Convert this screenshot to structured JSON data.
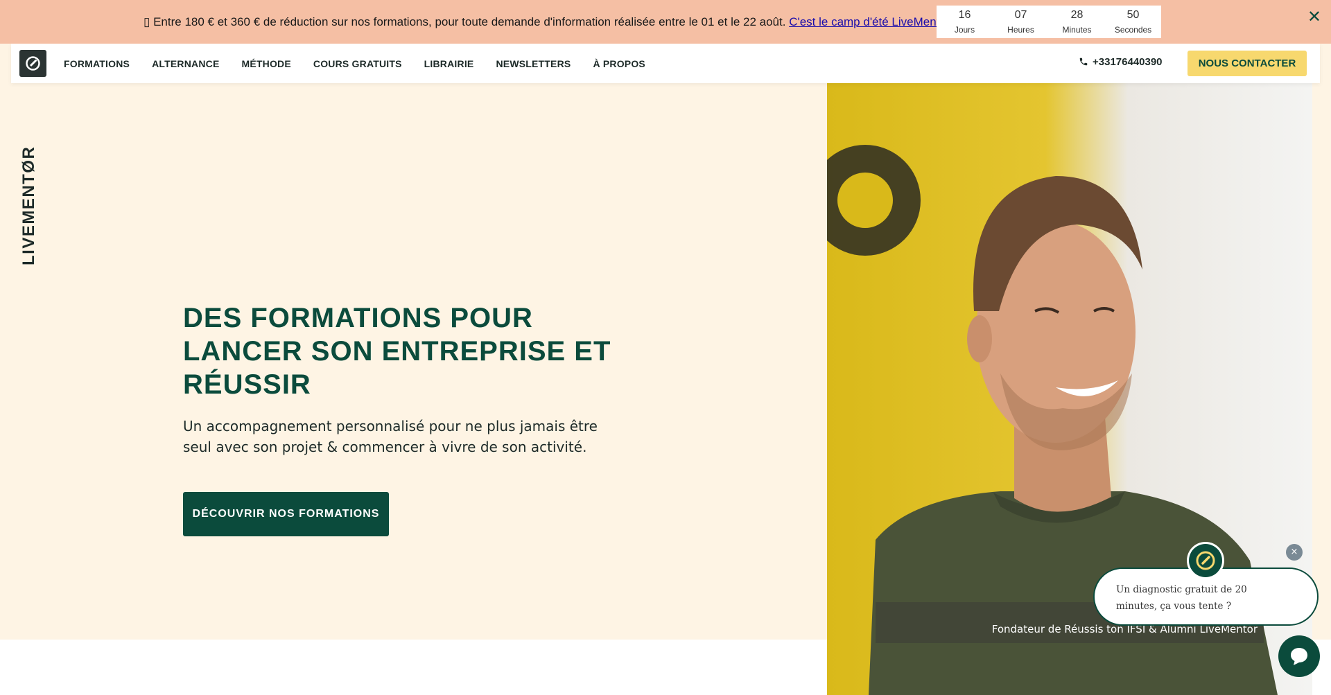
{
  "promo": {
    "icon": "megaphone-icon",
    "text": " Entre 180 € et 360 € de réduction sur nos formations, pour toute demande d'information réalisée entre le 01 et le 22 août. ",
    "link": "C'est le camp d'été LiveMentor.",
    "countdown": [
      {
        "value": "16",
        "unit": "Jours"
      },
      {
        "value": "07",
        "unit": "Heures"
      },
      {
        "value": "28",
        "unit": "Minutes"
      },
      {
        "value": "50",
        "unit": "Secondes"
      }
    ],
    "close": "✕"
  },
  "nav": {
    "items": [
      "FORMATIONS",
      "ALTERNANCE",
      "MÉTHODE",
      "COURS GRATUITS",
      "LIBRAIRIE",
      "NEWSLETTERS",
      "À PROPOS"
    ],
    "phone": "+33176440390",
    "contact": "NOUS CONTACTER"
  },
  "side_logo": "LIVEMENTØR",
  "hero": {
    "title": "DES FORMATIONS POUR LANCER SON ENTREPRISE ET RÉUSSIR",
    "subtitle": "Un accompagnement personnalisé pour ne plus jamais être seul avec son projet & commencer à vivre de son activité.",
    "cta": "DÉCOUVRIR NOS FORMATIONS",
    "caption": "Fondateur de Réussis ton IFSI & Alumni LiveMentor"
  },
  "chat": {
    "message": "Un diagnostic gratuit de 20 minutes, ça vous tente ?",
    "close": "×"
  },
  "colors": {
    "banner": "#f5bfa4",
    "hero_bg": "#fef4e4",
    "brand_green": "#0b4b3c",
    "accent_yellow": "#f7d86e"
  }
}
